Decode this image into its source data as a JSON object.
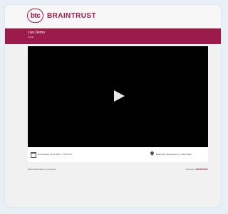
{
  "brand": {
    "badge": "btc",
    "name": "BRAINTRUST",
    "color": "#9b1b4b"
  },
  "event": {
    "name": "Live Demo",
    "subtitle": "details"
  },
  "player": {
    "play_icon": "play-icon"
  },
  "info": {
    "date": "Donnerstag, 01.01.2021 · 17:00 Uhr",
    "location": "Braintrust, Musterplatz 1, 12345 Wien"
  },
  "footer": {
    "left": "Datenschutzerklärung | Impressum",
    "powered_label": "Powered by",
    "powered_brand": "BRAINTRUST"
  }
}
